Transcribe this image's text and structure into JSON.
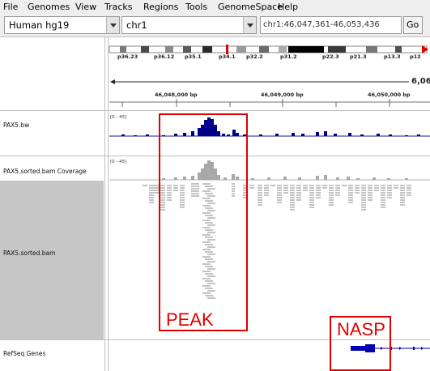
{
  "menu": [
    "File",
    "Genomes",
    "View",
    "Tracks",
    "Regions",
    "Tools",
    "GenomeSpace",
    "Help"
  ],
  "toolbar": {
    "genome": "Human hg19",
    "chromosome": "chr1",
    "locus": "chr1:46,047,361-46,053,436",
    "go_label": "Go"
  },
  "ideogram": {
    "bands": [
      "p36.23",
      "p36.12",
      "p35.1",
      "p34.1",
      "p32.2",
      "p31.2",
      "p22.3",
      "p21.3",
      "p13.3",
      "p12"
    ],
    "region_width_label": "6,06"
  },
  "ruler": {
    "ticks": [
      "46,048,000 bp",
      "46,049,000 bp",
      "46,050,000 bp"
    ]
  },
  "tracks": {
    "bigwig_name": "PAX5.bw",
    "bigwig_scale": "[0 - 45]",
    "coverage_name": "PAX5.sorted.bam Coverage",
    "coverage_scale": "[0 - 45]",
    "alignment_name": "PAX5.sorted.bam",
    "refseq_name": "RefSeq Genes"
  },
  "annotations": {
    "peak_label": "PEAK",
    "gene_label": "NASP"
  },
  "colors": {
    "bigwig": "#00008b",
    "coverage": "#a8a8a8",
    "reads": "#c4c4c4",
    "annotation": "#e00000",
    "gene": "#0000b0"
  }
}
